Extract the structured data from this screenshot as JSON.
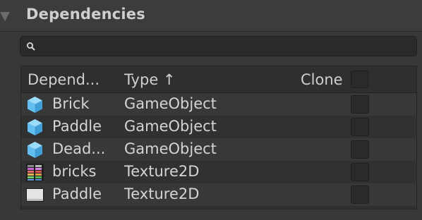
{
  "section": {
    "title": "Dependencies",
    "expanded": true
  },
  "search": {
    "value": "",
    "placeholder": ""
  },
  "table": {
    "columns": {
      "dependency": "Depend...",
      "type": "Type ↑",
      "clone": "Clone"
    },
    "rows": [
      {
        "name": "Brick",
        "type": "GameObject",
        "icon": "prefab-cube-icon",
        "clone": false
      },
      {
        "name": "Paddle",
        "type": "GameObject",
        "icon": "prefab-cube-icon",
        "clone": false
      },
      {
        "name": "Dead...",
        "type": "GameObject",
        "icon": "prefab-cube-icon",
        "clone": false
      },
      {
        "name": "bricks",
        "type": "Texture2D",
        "icon": "bricks-texture-icon",
        "clone": false
      },
      {
        "name": "Paddle",
        "type": "Texture2D",
        "icon": "paddle-texture-icon",
        "clone": false
      }
    ]
  },
  "colors": {
    "background": "#383838",
    "row_alt": "#313131",
    "cube_light": "#7fcdf5",
    "cube_dark": "#3f9fd6"
  }
}
